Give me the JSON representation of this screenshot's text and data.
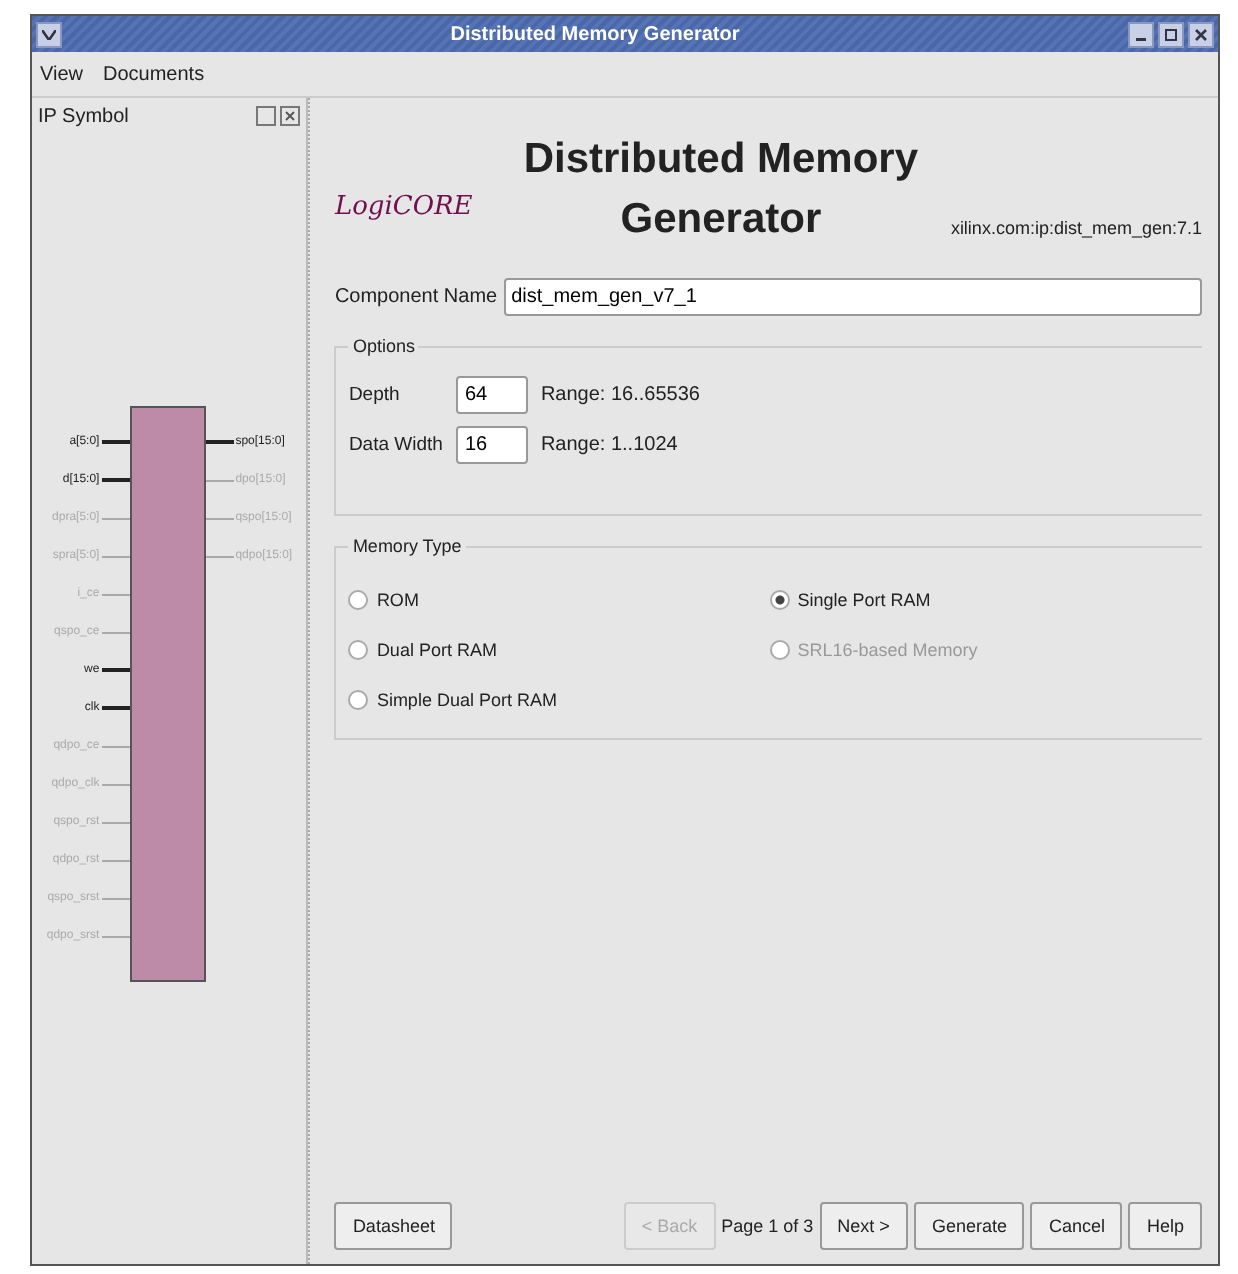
{
  "window": {
    "title": "Distributed Memory Generator"
  },
  "menu": [
    {
      "label": "View"
    },
    {
      "label": "Documents"
    }
  ],
  "ip_symbol": {
    "title": "IP Symbol",
    "inputs": [
      {
        "label": "a[5:0]",
        "enabled": true
      },
      {
        "label": "d[15:0]",
        "enabled": true
      },
      {
        "label": "dpra[5:0]",
        "enabled": false
      },
      {
        "label": "spra[5:0]",
        "enabled": false
      },
      {
        "label": "i_ce",
        "enabled": false
      },
      {
        "label": "qspo_ce",
        "enabled": false
      },
      {
        "label": "we",
        "enabled": true
      },
      {
        "label": "clk",
        "enabled": true
      },
      {
        "label": "qdpo_ce",
        "enabled": false
      },
      {
        "label": "qdpo_clk",
        "enabled": false
      },
      {
        "label": "qspo_rst",
        "enabled": false
      },
      {
        "label": "qdpo_rst",
        "enabled": false
      },
      {
        "label": "qspo_srst",
        "enabled": false
      },
      {
        "label": "qdpo_srst",
        "enabled": false
      }
    ],
    "outputs": [
      {
        "label": "spo[15:0]",
        "enabled": true
      },
      {
        "label": "dpo[15:0]",
        "enabled": false
      },
      {
        "label": "qspo[15:0]",
        "enabled": false
      },
      {
        "label": "qdpo[15:0]",
        "enabled": false
      }
    ]
  },
  "header": {
    "logo": "LogiCORE",
    "title": "Distributed Memory Generator",
    "vlnv": "xilinx.com:ip:dist_mem_gen:7.1"
  },
  "component_name": {
    "label": "Component Name",
    "value": "dist_mem_gen_v7_1"
  },
  "options": {
    "title": "Options",
    "fields": [
      {
        "label": "Depth",
        "value": "64",
        "range": "Range: 16..65536"
      },
      {
        "label": "Data Width",
        "value": "16",
        "range": "Range: 1..1024"
      }
    ]
  },
  "memory_type": {
    "title": "Memory Type",
    "choices": [
      {
        "label": "ROM",
        "selected": false,
        "disabled": false
      },
      {
        "label": "Single Port RAM",
        "selected": true,
        "disabled": false
      },
      {
        "label": "Dual Port RAM",
        "selected": false,
        "disabled": false
      },
      {
        "label": "SRL16-based Memory",
        "selected": false,
        "disabled": true
      },
      {
        "label": "Simple Dual Port RAM",
        "selected": false,
        "disabled": false
      }
    ]
  },
  "buttons": [
    {
      "label": "Datasheet",
      "kind": "left",
      "disabled": false
    },
    {
      "label": "< Back",
      "kind": "nav",
      "disabled": true
    },
    {
      "label": "Page 1 of 3",
      "kind": "text"
    },
    {
      "label": "Next >",
      "kind": "nav",
      "disabled": false
    },
    {
      "label": "Generate",
      "kind": "nav",
      "disabled": false
    },
    {
      "label": "Cancel",
      "kind": "nav",
      "disabled": false
    },
    {
      "label": "Help",
      "kind": "nav",
      "disabled": false
    }
  ]
}
